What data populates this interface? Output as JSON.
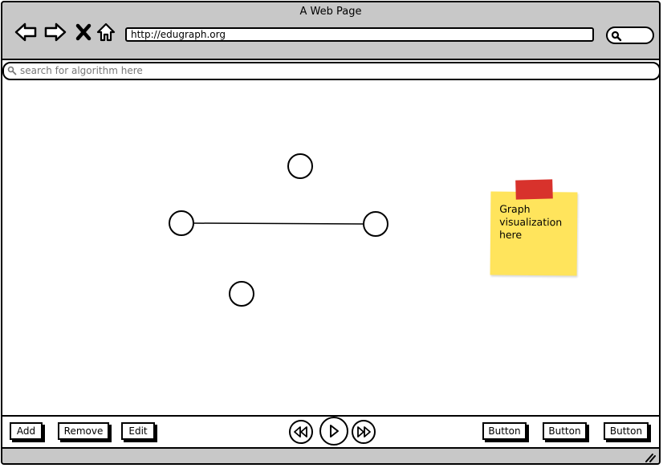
{
  "window": {
    "title": "A Web Page"
  },
  "browser": {
    "url": "http://edugraph.org"
  },
  "search": {
    "placeholder": "search for algorithm here"
  },
  "sticky_note": {
    "text": "Graph visualization here"
  },
  "toolbar": {
    "add_label": "Add",
    "remove_label": "Remove",
    "edit_label": "Edit",
    "right_buttons": [
      "Button",
      "Button",
      "Button"
    ]
  },
  "colors": {
    "sticky": "#ffe45c",
    "tape": "#d8322c",
    "chrome": "#c8c8c8"
  }
}
